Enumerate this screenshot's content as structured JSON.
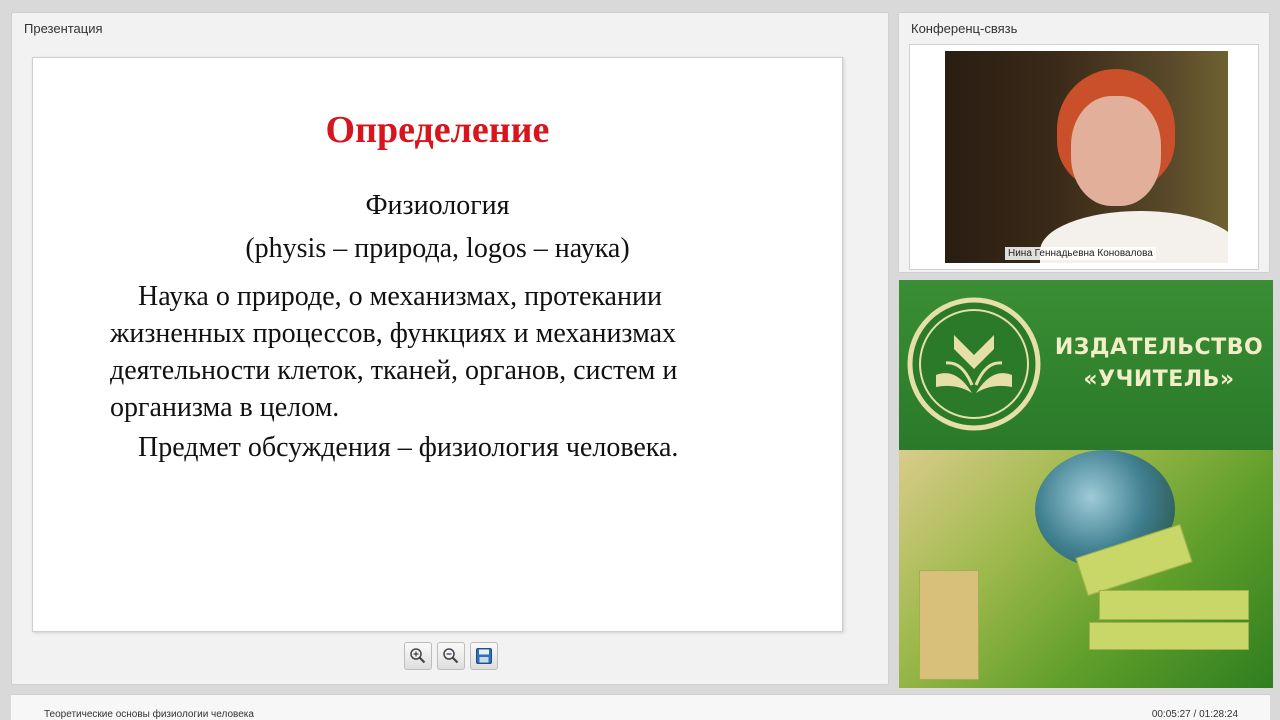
{
  "presentation": {
    "title": "Презентация",
    "slide": {
      "heading": "Определение",
      "term": "Физиология",
      "etymology": "(physis – природа, logos – наука)",
      "paragraph": "Наука о природе, о механизмах, протекании жизненных процессов, функциях и механизмах деятельности клеток, тканей, органов, систем и организма в целом.",
      "subject": "Предмет обсуждения – физиология человека.",
      "heading_color": "#d8141c"
    },
    "toolbar": {
      "zoom_in_icon": "zoom-in-icon",
      "zoom_out_icon": "zoom-out-icon",
      "save_icon": "save-icon"
    }
  },
  "conference": {
    "title": "Конференц-связь",
    "speaker_name": "Нина Геннадьевна Коновалова"
  },
  "banner": {
    "publisher_line1": "ИЗДАТЕЛЬСТВО",
    "publisher_line2": "«УЧИТЕЛЬ»",
    "brand_color": "#2b7a2b"
  },
  "footer": {
    "course_title": "Теоретические основы физиологии человека",
    "time": "00:05:27 / 01:28:24"
  }
}
